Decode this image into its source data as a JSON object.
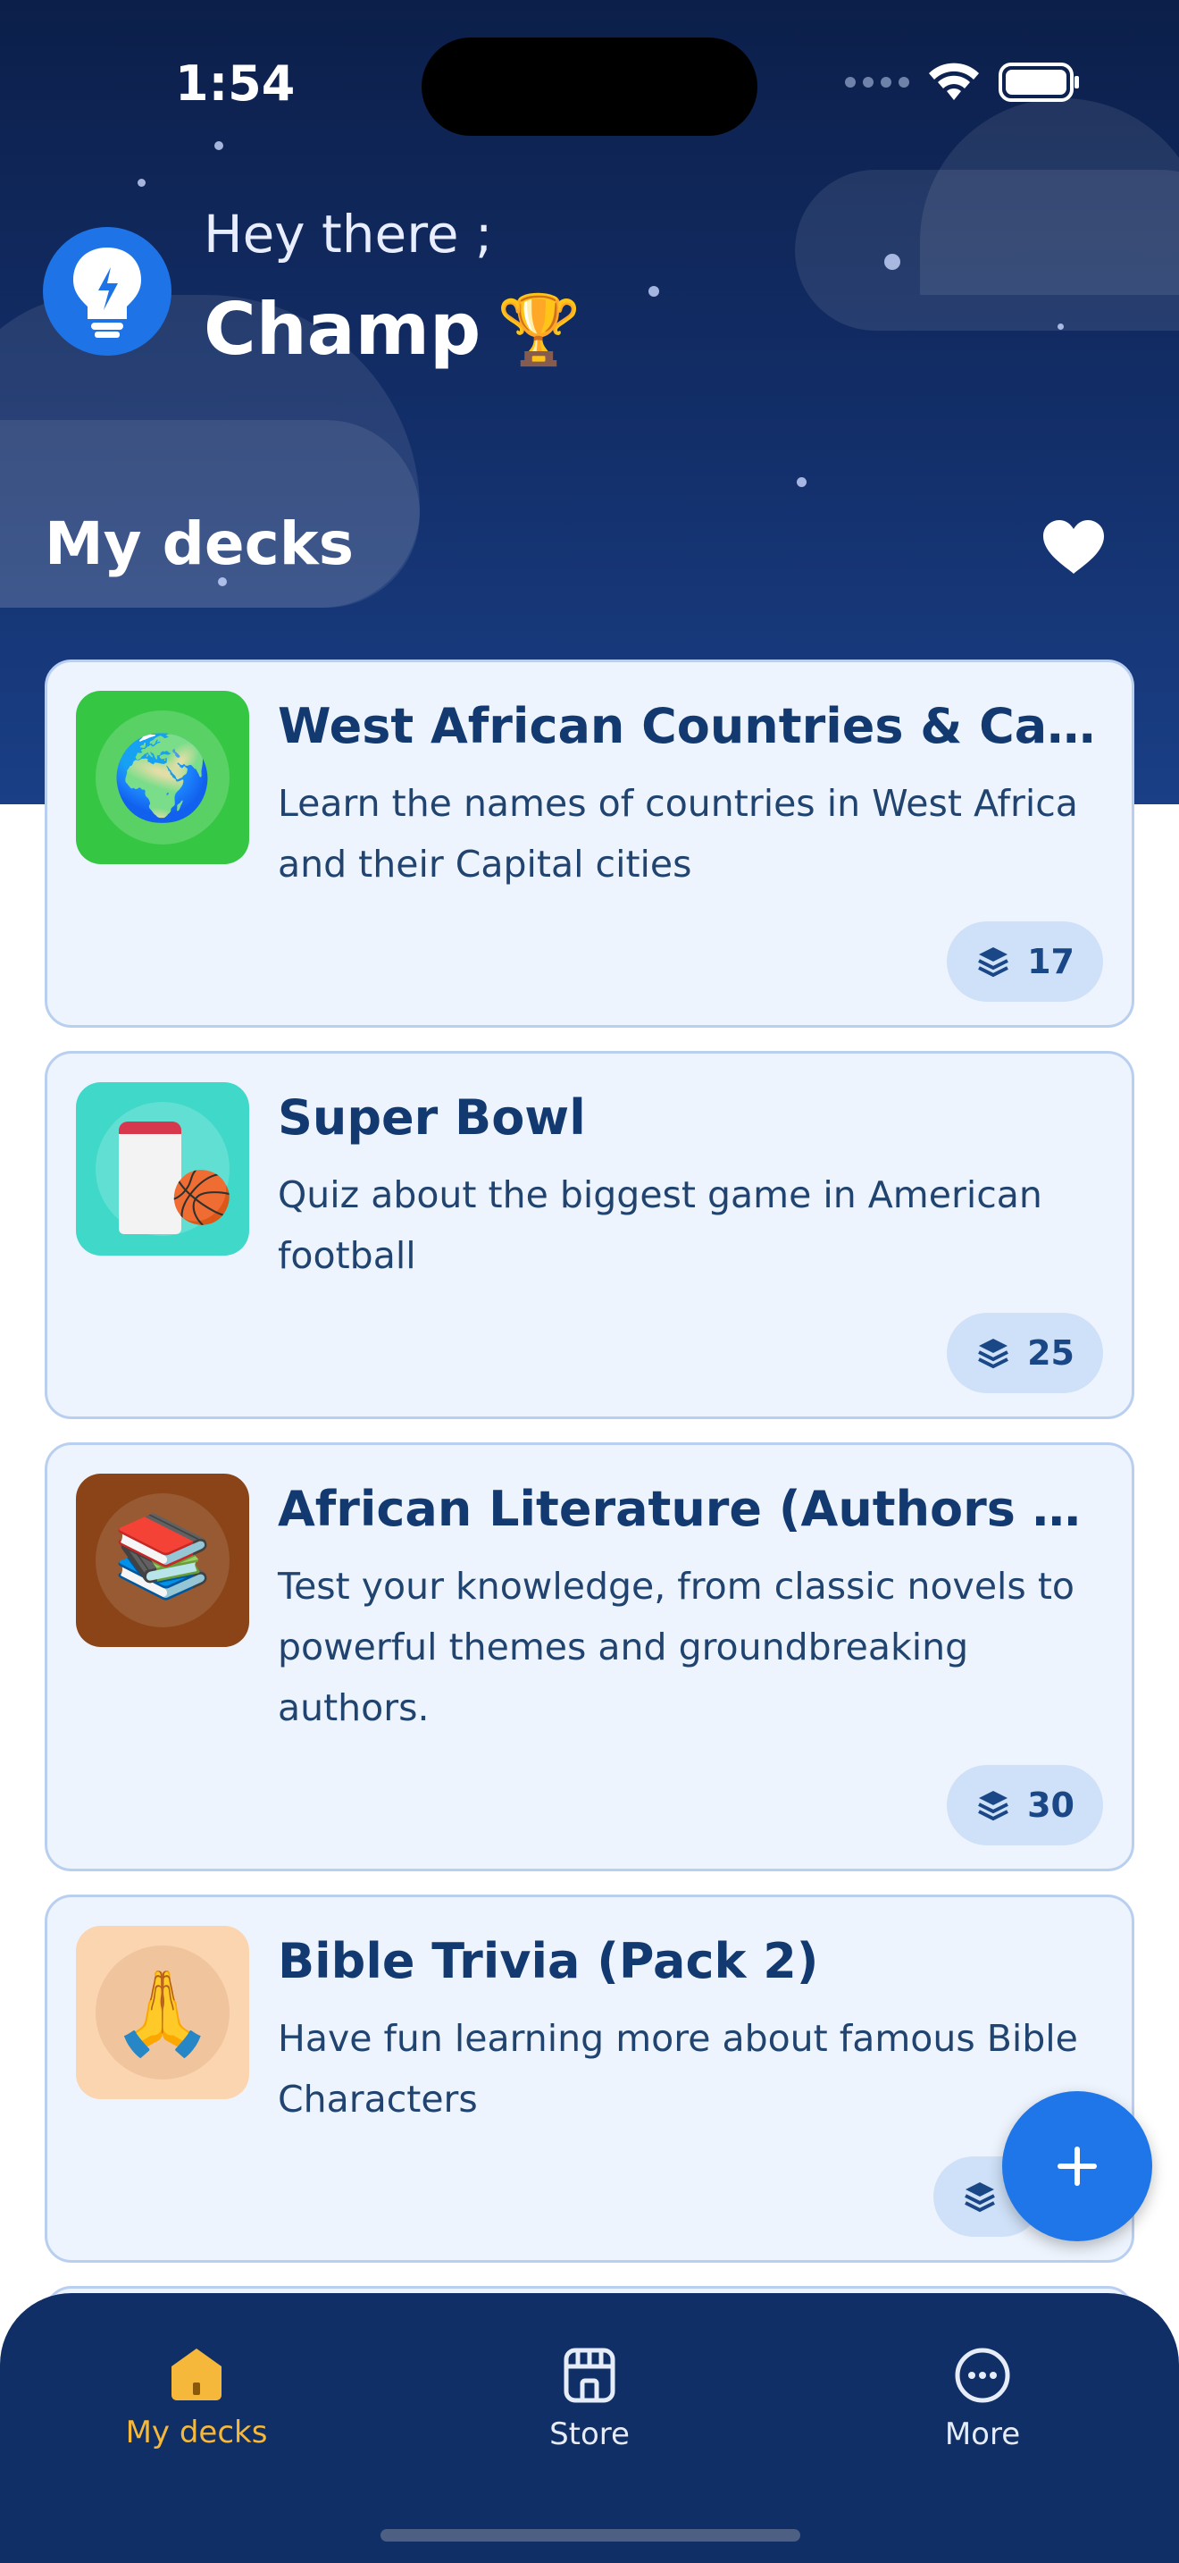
{
  "status_bar": {
    "time": "1:54"
  },
  "header": {
    "greeting": "Hey there ;",
    "name": "Champ",
    "name_emoji": "🏆"
  },
  "section": {
    "title": "My decks"
  },
  "decks": [
    {
      "title": "West African Countries & Capitals",
      "description": "Learn the names of countries in West Africa and their Capital cities",
      "count": "17",
      "thumb_emoji": "🌍",
      "thumb_color": "#35c743"
    },
    {
      "title": "Super Bowl",
      "description": "Quiz about the biggest game in American football",
      "count": "25",
      "thumb_emoji": "🏀",
      "thumb_color": "#3fd8c9"
    },
    {
      "title": "African Literature (Authors and works)",
      "description": "Test your knowledge, from classic novels to powerful themes and groundbreaking authors.",
      "count": "30",
      "thumb_emoji": "📚",
      "thumb_color": "#8a4417"
    },
    {
      "title": "Bible Trivia (Pack 2)",
      "description": "Have fun learning more about famous Bible Characters",
      "count": "",
      "thumb_emoji": "🙏",
      "thumb_color": "#fbd4b0"
    }
  ],
  "bottom_nav": {
    "items": [
      {
        "label": "My decks",
        "icon": "home-icon",
        "active": true
      },
      {
        "label": "Store",
        "icon": "store-icon",
        "active": false
      },
      {
        "label": "More",
        "icon": "more-icon",
        "active": false
      }
    ]
  },
  "colors": {
    "accent": "#1f76e8",
    "active_nav": "#f5b83a",
    "nav_bg": "#0f2f66",
    "hero_bg": "#132f6a"
  }
}
